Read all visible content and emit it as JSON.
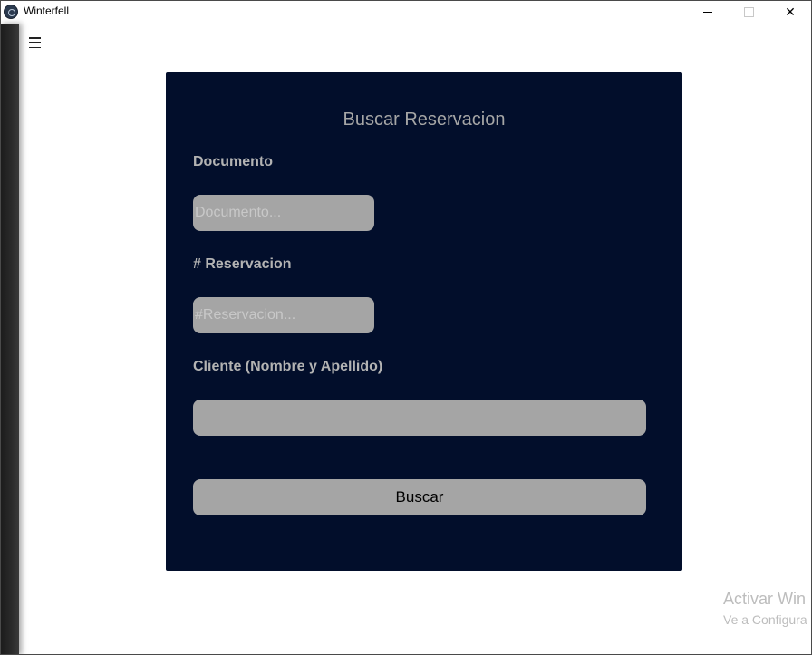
{
  "window": {
    "title": "Winterfell",
    "minimize": "minimize",
    "maximize": "maximize",
    "close": "✕"
  },
  "form": {
    "title": "Buscar Reservacion",
    "documento": {
      "label": "Documento",
      "placeholder": "Documento...",
      "value": ""
    },
    "reservacion": {
      "label": "# Reservacion",
      "placeholder": "#Reservacion...",
      "value": ""
    },
    "cliente": {
      "label": "Cliente (Nombre y Apellido)",
      "placeholder": "",
      "value": ""
    },
    "submit_label": "Buscar"
  },
  "watermark": {
    "line1": "Activar Win",
    "line2": "Ve a Configura"
  },
  "colors": {
    "card_bg": "#020e2b",
    "field_bg": "#a5a5a5",
    "label_text": "#b3b3b3"
  },
  "icons": [
    "app-icon",
    "hamburger-menu-icon",
    "minimize-icon",
    "maximize-icon",
    "close-icon"
  ]
}
